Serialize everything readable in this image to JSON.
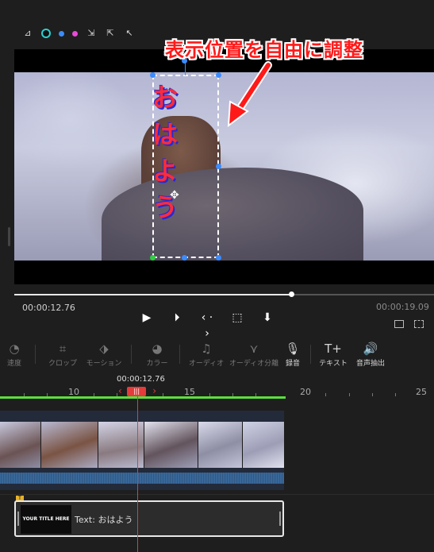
{
  "toolbar": {
    "icons": [
      "crop-grid-icon",
      "color-ring-icon",
      "dot-blue-icon",
      "dot-pink-icon",
      "pointer-plus-icon",
      "pointer-select-icon",
      "pointer-cursor-icon"
    ],
    "colors": {
      "ring": "#2bd1d1",
      "blue": "#3b8bff",
      "pink": "#e84ad8"
    }
  },
  "preview": {
    "overlay_text": [
      "お",
      "は",
      "よ",
      "う"
    ],
    "callout_text": "表示位置を自由に調整"
  },
  "playback": {
    "current_time": "00:00:12.76",
    "total_time": "00:00:19.09",
    "progress_fraction": 0.66
  },
  "edit_tools": [
    {
      "label": "速度",
      "icon": "speed-icon",
      "enabled": false
    },
    {
      "label": "クロップ",
      "icon": "crop-icon",
      "enabled": false
    },
    {
      "label": "モーション",
      "icon": "motion-icon",
      "enabled": false
    },
    {
      "label": "カラー",
      "icon": "palette-icon",
      "enabled": false
    },
    {
      "label": "オーディオ",
      "icon": "audio-note-icon",
      "enabled": false
    },
    {
      "label": "オーディオ分離",
      "icon": "audio-split-icon",
      "enabled": false
    },
    {
      "label": "録音",
      "icon": "microphone-icon",
      "enabled": true
    },
    {
      "label": "テキスト",
      "icon": "text-add-icon",
      "enabled": true
    },
    {
      "label": "音声抽出",
      "icon": "audio-extract-icon",
      "enabled": true
    }
  ],
  "timeline": {
    "playhead_time": "00:00:12.76",
    "ruler_labels": [
      "10",
      "15",
      "20",
      "25"
    ],
    "text_clip": {
      "thumb": "YOUR TITLE HERE",
      "label": "Text: おはよう"
    }
  }
}
